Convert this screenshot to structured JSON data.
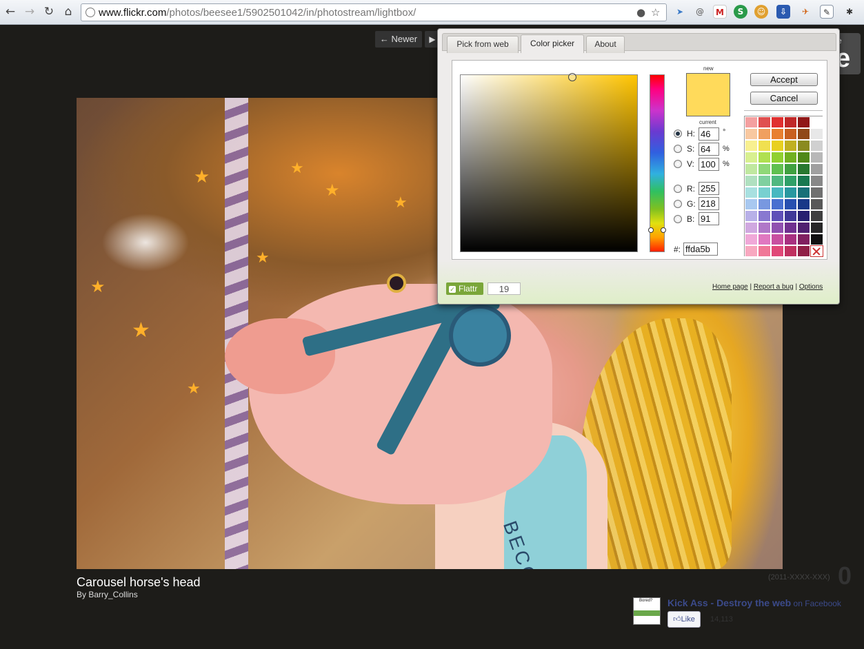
{
  "browser": {
    "url_host": "www.flickr.com",
    "url_path": "/photos/beesee1/5902501042/in/photostream/lightbox/"
  },
  "lightbox": {
    "newer_label": "← Newer",
    "next_label": "▶",
    "close_fragment_top": "e",
    "close_fragment_big": "e",
    "photo_title": "Carousel horse's head",
    "byline": "By Barry_Collins",
    "band_text": "BECCA",
    "faded_text": "(2011-XXXX-XXX)",
    "big_count": "0",
    "fb_thumb_text": "Bored?",
    "fb_title": "Kick Ass - Destroy the web",
    "fb_suffix": " on Facebook",
    "like_label": "Like",
    "like_count": "14,113"
  },
  "picker": {
    "tabs": [
      {
        "label": "Pick from web",
        "active": false
      },
      {
        "label": "Color picker",
        "active": true
      },
      {
        "label": "About",
        "active": false
      }
    ],
    "new_label": "new",
    "current_label": "current",
    "new_color": "#ffda5b",
    "current_color": "#ffda5b",
    "hsv": [
      {
        "label": "H:",
        "value": "46",
        "unit": "°",
        "selected": true
      },
      {
        "label": "S:",
        "value": "64",
        "unit": "%",
        "selected": false
      },
      {
        "label": "V:",
        "value": "100",
        "unit": "%",
        "selected": false
      }
    ],
    "rgb": [
      {
        "label": "R:",
        "value": "255",
        "selected": false
      },
      {
        "label": "G:",
        "value": "218",
        "selected": false
      },
      {
        "label": "B:",
        "value": "91",
        "selected": false
      }
    ],
    "hex_label": "#:",
    "hex_value": "ffda5b",
    "accept_label": "Accept",
    "cancel_label": "Cancel",
    "palette": [
      [
        "#f4a0a0",
        "#e05050",
        "#e03030",
        "#c02828",
        "#901818",
        "#ffffff"
      ],
      [
        "#f8c8a0",
        "#f0a060",
        "#e88030",
        "#c86020",
        "#904818",
        "#e8e8e8"
      ],
      [
        "#f8f090",
        "#f0e050",
        "#e8d020",
        "#c0b020",
        "#8a8a20",
        "#d0d0d0"
      ],
      [
        "#d8f090",
        "#b0e050",
        "#90d030",
        "#70b020",
        "#508818",
        "#b8b8b8"
      ],
      [
        "#c0e8a0",
        "#90d878",
        "#60c050",
        "#40a040",
        "#287830",
        "#a0a0a0"
      ],
      [
        "#b0e0c0",
        "#80d0a0",
        "#50b880",
        "#30a068",
        "#187850",
        "#888888"
      ],
      [
        "#a8e0e0",
        "#78d0d0",
        "#48b8c0",
        "#2898a0",
        "#187078",
        "#707070"
      ],
      [
        "#a8c8f0",
        "#7898e0",
        "#4870d0",
        "#2850b0",
        "#183888",
        "#585858"
      ],
      [
        "#b8b0e8",
        "#8878d0",
        "#6050b8",
        "#403898",
        "#282070",
        "#404040"
      ],
      [
        "#d0a8e0",
        "#b078c8",
        "#9050b0",
        "#703090",
        "#502070",
        "#282828"
      ],
      [
        "#f0a8d8",
        "#e078c0",
        "#c850a0",
        "#a83080",
        "#802060",
        "#101010"
      ],
      [
        "#f8a8c0",
        "#f07898",
        "#e04878",
        "#c03060",
        "#902048",
        "none"
      ]
    ],
    "flattr_label": "Flattr",
    "flattr_count": "19",
    "links": {
      "home": "Home page",
      "bug": "Report a bug",
      "options": "Options",
      "separator": " | "
    }
  }
}
